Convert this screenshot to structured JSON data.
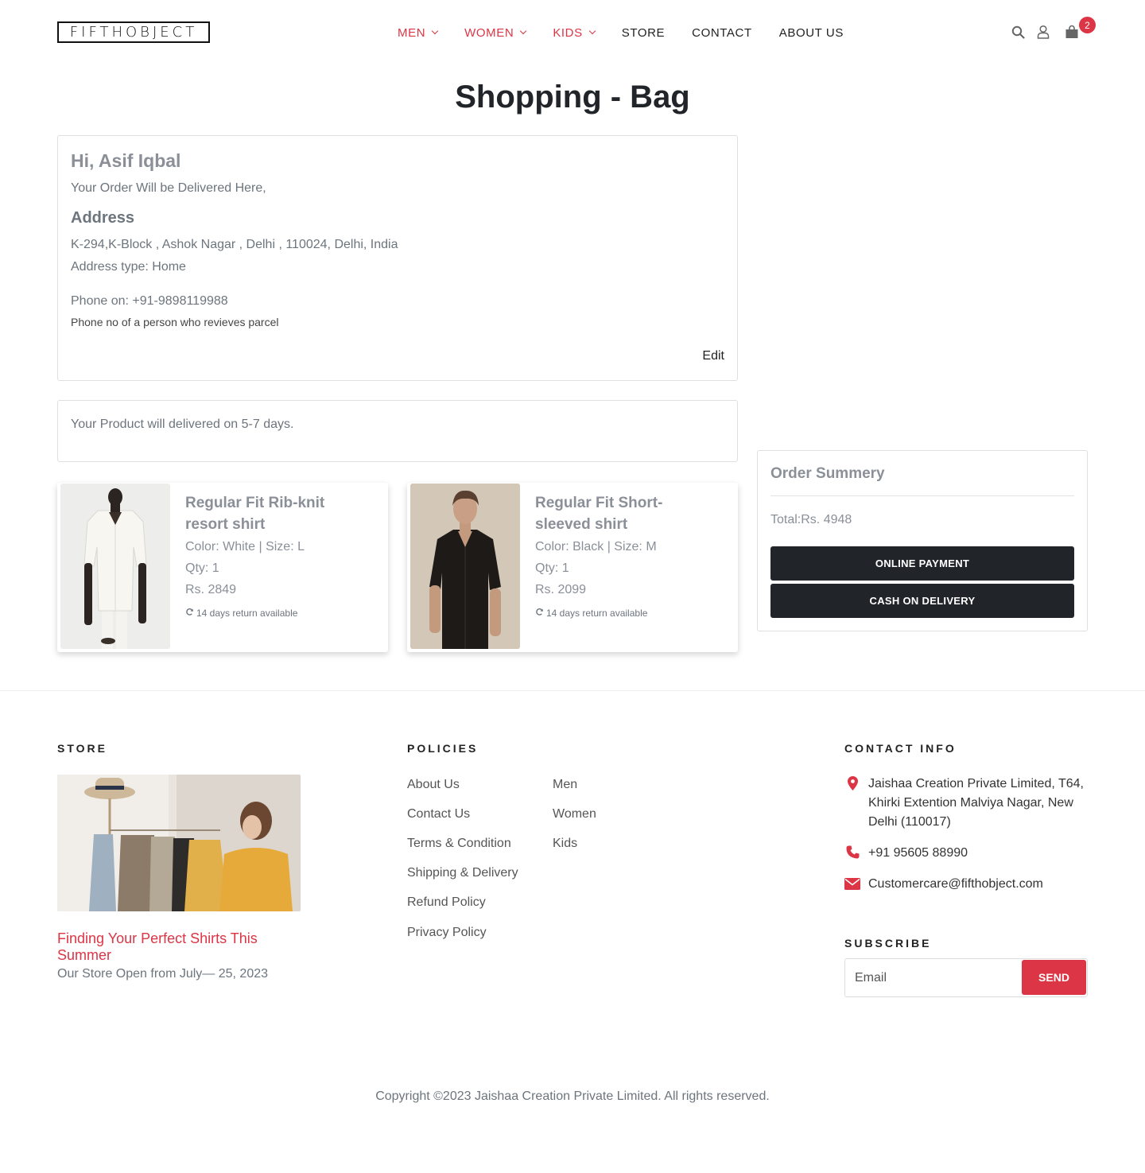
{
  "brand": {
    "logo": "FIFTHOBJECT"
  },
  "nav": {
    "items": [
      {
        "label": "MEN",
        "dropdown": true
      },
      {
        "label": "WOMEN",
        "dropdown": true
      },
      {
        "label": "KIDS",
        "dropdown": true
      },
      {
        "label": "STORE",
        "dropdown": false
      },
      {
        "label": "CONTACT",
        "dropdown": false
      },
      {
        "label": "ABOUT US",
        "dropdown": false
      }
    ],
    "icons": [
      "search-icon",
      "user-icon",
      "shopping-bag-icon"
    ],
    "cart_count": "2"
  },
  "page": {
    "title": "Shopping - Bag"
  },
  "address_card": {
    "greeting": "Hi, Asif Iqbal",
    "intro": "Your Order Will be Delivered Here,",
    "heading": "Address",
    "address": "K-294,K-Block , Ashok Nagar , Delhi , 110024, Delhi, India",
    "address_type": "Address type: Home",
    "phone": "Phone on: +91-9898119988",
    "phone_note": "Phone no of a person who revieves parcel",
    "edit_label": "Edit"
  },
  "delivery": {
    "text": "Your Product will delivered on 5-7 days."
  },
  "products": [
    {
      "title": "Regular Fit Rib-knit resort shirt",
      "color_size": "Color: White |  Size: L",
      "qty": "Qty: 1",
      "price": "Rs. 2849",
      "return_text": "14 days return available"
    },
    {
      "title": "Regular Fit Short-sleeved shirt",
      "color_size": "Color: Black |  Size: M",
      "qty": "Qty: 1",
      "price": "Rs. 2099",
      "return_text": "14 days return available"
    }
  ],
  "summary": {
    "title": "Order Summery",
    "total": "Total:Rs. 4948",
    "online_payment": "ONLINE PAYMENT",
    "cod": "CASH ON DELIVERY"
  },
  "footer": {
    "store": {
      "heading": "STORE",
      "link": "Finding Your Perfect Shirts This Summer",
      "date": "Our Store Open from July— 25, 2023"
    },
    "policies": {
      "heading": "POLICIES",
      "col1": [
        "About Us",
        "Contact Us",
        "Terms & Condition",
        "Shipping & Delivery",
        "Refund Policy",
        "Privacy Policy"
      ],
      "col2": [
        "Men",
        "Women",
        "Kids"
      ]
    },
    "contact": {
      "heading": "CONTACT INFO",
      "address_line1": "Jaishaa Creation Private Limited, T64,",
      "address_line2": "Khirki Extention Malviya Nagar, New",
      "address_line3": "Delhi (110017)",
      "phone": "+91 95605 88990",
      "email": "Customercare@fifthobject.com"
    },
    "subscribe": {
      "heading": "SUBSCRIBE",
      "placeholder": "Email",
      "button": "SEND"
    },
    "copyright": "Copyright ©2023 Jaishaa Creation Private Limited. All rights reserved."
  },
  "colors": {
    "accent": "#dc3545",
    "dark_button": "#212529",
    "muted": "#6c757d"
  }
}
